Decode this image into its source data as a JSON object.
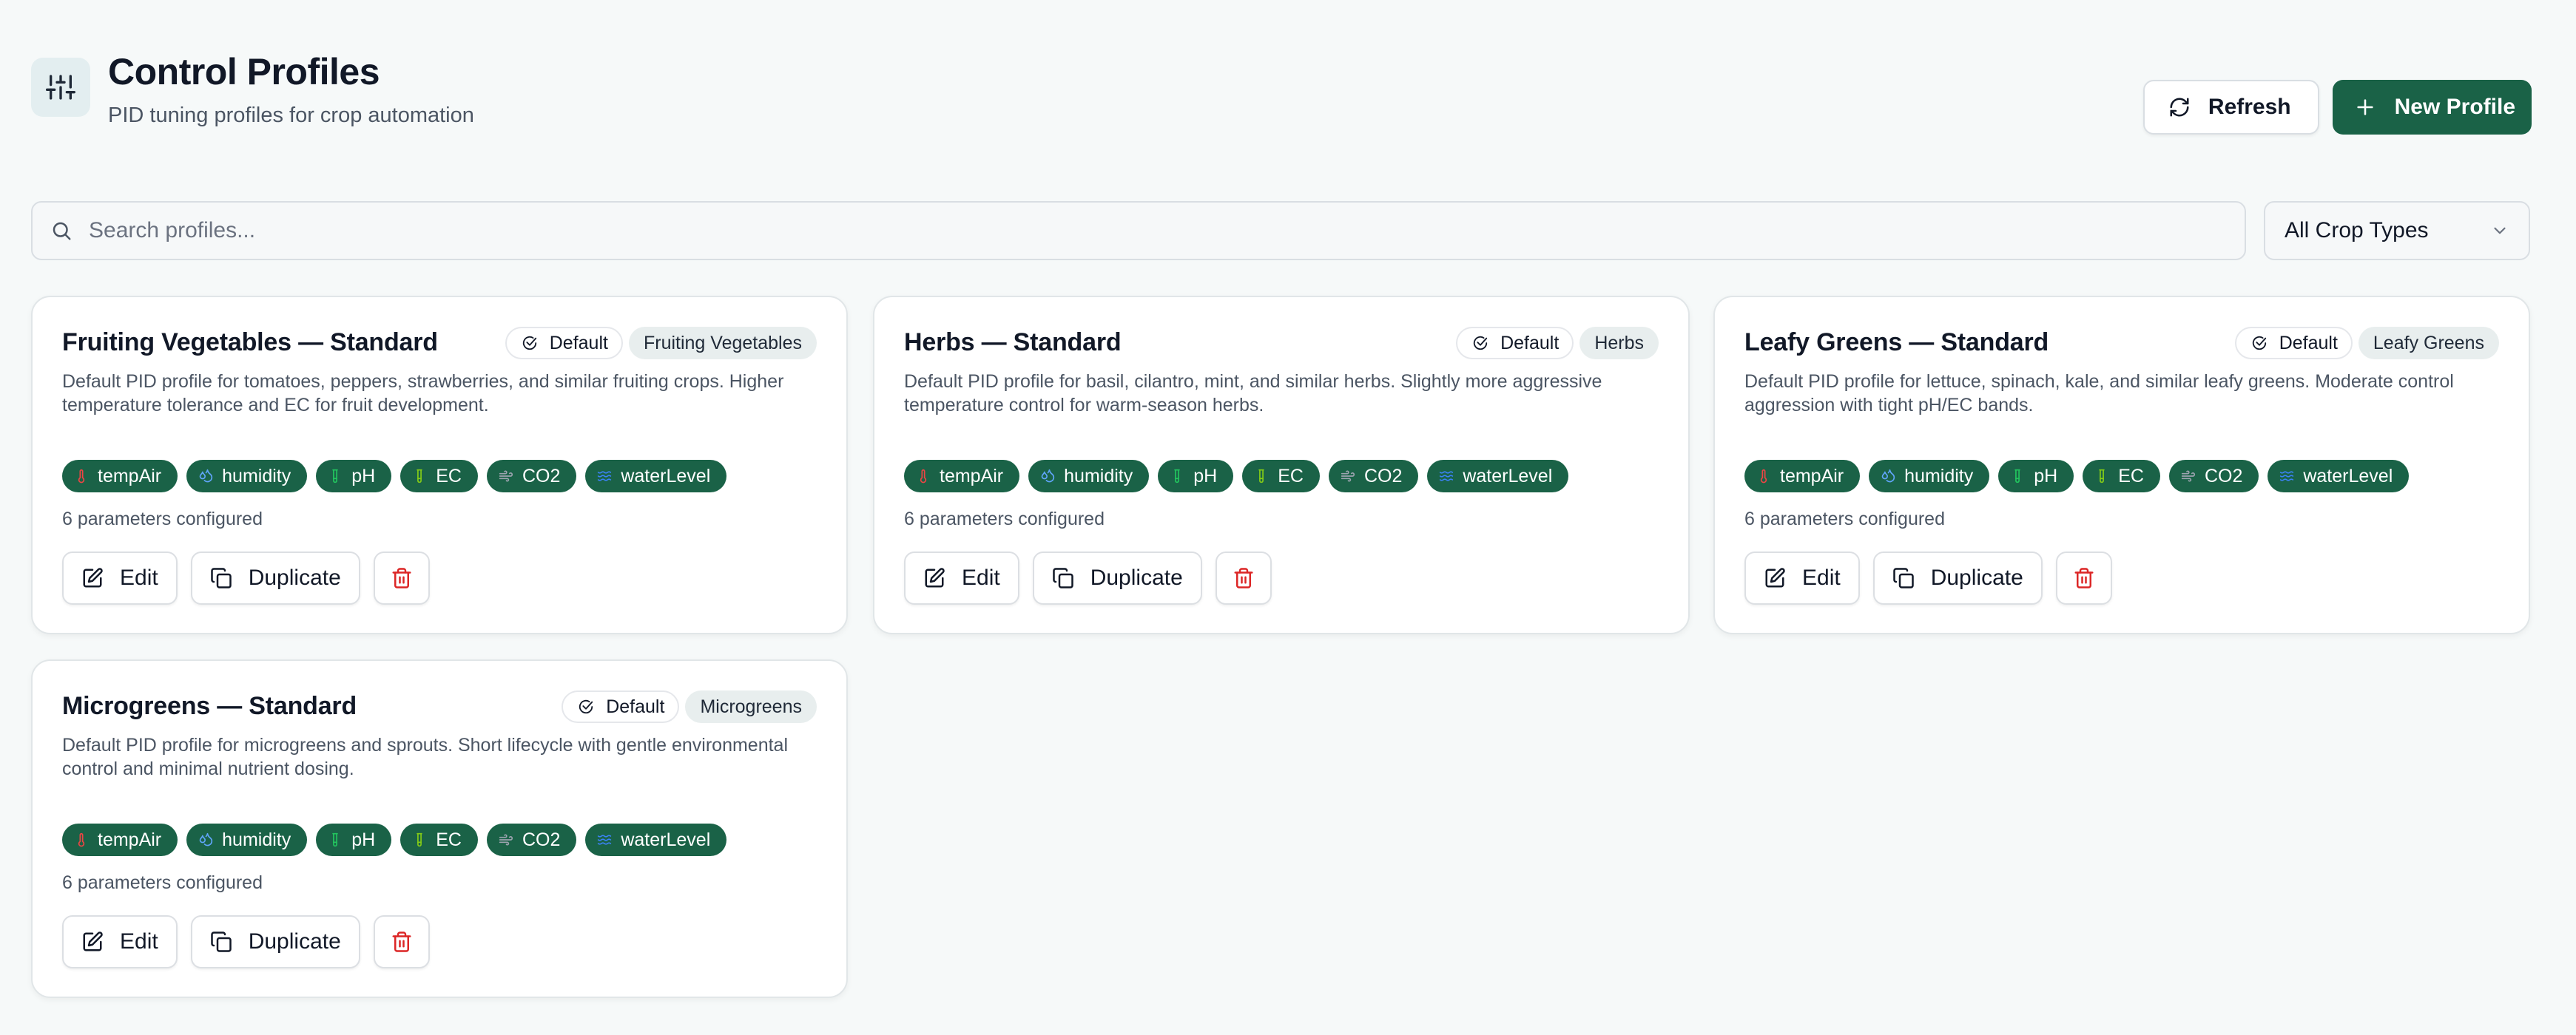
{
  "header": {
    "title": "Control Profiles",
    "subtitle": "PID tuning profiles for crop automation",
    "refresh_label": "Refresh",
    "new_profile_label": "New Profile"
  },
  "filters": {
    "search_placeholder": "Search profiles...",
    "crop_type_selected": "All Crop Types"
  },
  "colors": {
    "primary": "#1a6247",
    "danger": "#dc2626",
    "temp_icon": "#ef4444",
    "humidity_icon": "#60a5fa",
    "ph_icon": "#22c55e",
    "ec_icon": "#84cc16",
    "co2_icon": "#9ca3af",
    "water_icon": "#3b82f6"
  },
  "profiles": [
    {
      "title": "Fruiting Vegetables — Standard",
      "default_label": "Default",
      "crop_type": "Fruiting Vegetables",
      "description_line1": "Default PID profile for tomatoes, peppers, strawberries, and similar fruiting crops. Higher",
      "description_line2": "temperature tolerance and EC for fruit development.",
      "parameters": [
        "tempAir",
        "humidity",
        "pH",
        "EC",
        "CO2",
        "waterLevel"
      ],
      "param_count": "6 parameters configured",
      "edit_label": "Edit",
      "duplicate_label": "Duplicate"
    },
    {
      "title": "Herbs — Standard",
      "default_label": "Default",
      "crop_type": "Herbs",
      "description_line1": "Default PID profile for basil, cilantro, mint, and similar herbs. Slightly more aggressive",
      "description_line2": "temperature control for warm-season herbs.",
      "parameters": [
        "tempAir",
        "humidity",
        "pH",
        "EC",
        "CO2",
        "waterLevel"
      ],
      "param_count": "6 parameters configured",
      "edit_label": "Edit",
      "duplicate_label": "Duplicate"
    },
    {
      "title": "Leafy Greens — Standard",
      "default_label": "Default",
      "crop_type": "Leafy Greens",
      "description_line1": "Default PID profile for lettuce, spinach, kale, and similar leafy greens. Moderate control",
      "description_line2": "aggression with tight pH/EC bands.",
      "parameters": [
        "tempAir",
        "humidity",
        "pH",
        "EC",
        "CO2",
        "waterLevel"
      ],
      "param_count": "6 parameters configured",
      "edit_label": "Edit",
      "duplicate_label": "Duplicate"
    },
    {
      "title": "Microgreens — Standard",
      "default_label": "Default",
      "crop_type": "Microgreens",
      "description_line1": "Default PID profile for microgreens and sprouts. Short lifecycle with gentle environmental",
      "description_line2": "control and minimal nutrient dosing.",
      "parameters": [
        "tempAir",
        "humidity",
        "pH",
        "EC",
        "CO2",
        "waterLevel"
      ],
      "param_count": "6 parameters configured",
      "edit_label": "Edit",
      "duplicate_label": "Duplicate"
    }
  ]
}
